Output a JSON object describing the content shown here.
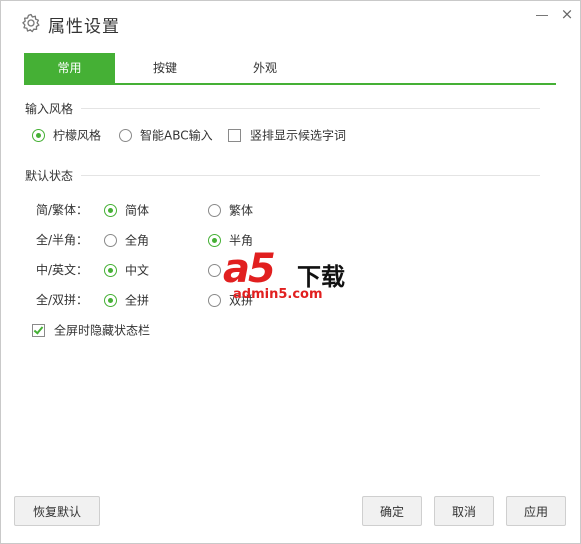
{
  "window": {
    "title": "属性设置",
    "icon": "gear-icon",
    "controls": {
      "minimize": "minimize-icon",
      "close": "×"
    }
  },
  "tabs": [
    {
      "label": "常用",
      "active": true
    },
    {
      "label": "按键",
      "active": false
    },
    {
      "label": "外观",
      "active": false
    }
  ],
  "input_style": {
    "title": "输入风格",
    "options": [
      {
        "label": "柠檬风格",
        "type": "radio",
        "checked": true
      },
      {
        "label": "智能ABC输入",
        "type": "radio",
        "checked": false
      },
      {
        "label": "竖排显示候选字词",
        "type": "checkbox",
        "checked": false
      }
    ]
  },
  "default_state": {
    "title": "默认状态",
    "rows": [
      {
        "label": "简/繁体：",
        "option_a": {
          "label": "简体",
          "checked": true
        },
        "option_b": {
          "label": "繁体",
          "checked": false
        }
      },
      {
        "label": "全/半角：",
        "option_a": {
          "label": "全角",
          "checked": false
        },
        "option_b": {
          "label": "半角",
          "checked": true
        }
      },
      {
        "label": "中/英文：",
        "option_a": {
          "label": "中文",
          "checked": true
        },
        "option_b": {
          "label": "",
          "checked": false
        }
      },
      {
        "label": "全/双拼：",
        "option_a": {
          "label": "全拼",
          "checked": true
        },
        "option_b": {
          "label": "双拼",
          "checked": false
        }
      }
    ],
    "hide_statusbar": {
      "label": "全屏时隐藏状态栏",
      "checked": true
    }
  },
  "watermark": {
    "main": "a5",
    "suffix": "下载",
    "url": "admin5.com"
  },
  "buttons": {
    "restore": "恢复默认",
    "ok": "确定",
    "cancel": "取消",
    "apply": "应用"
  },
  "colors": {
    "accent": "#45b035",
    "watermark_red": "#e11f1f"
  }
}
